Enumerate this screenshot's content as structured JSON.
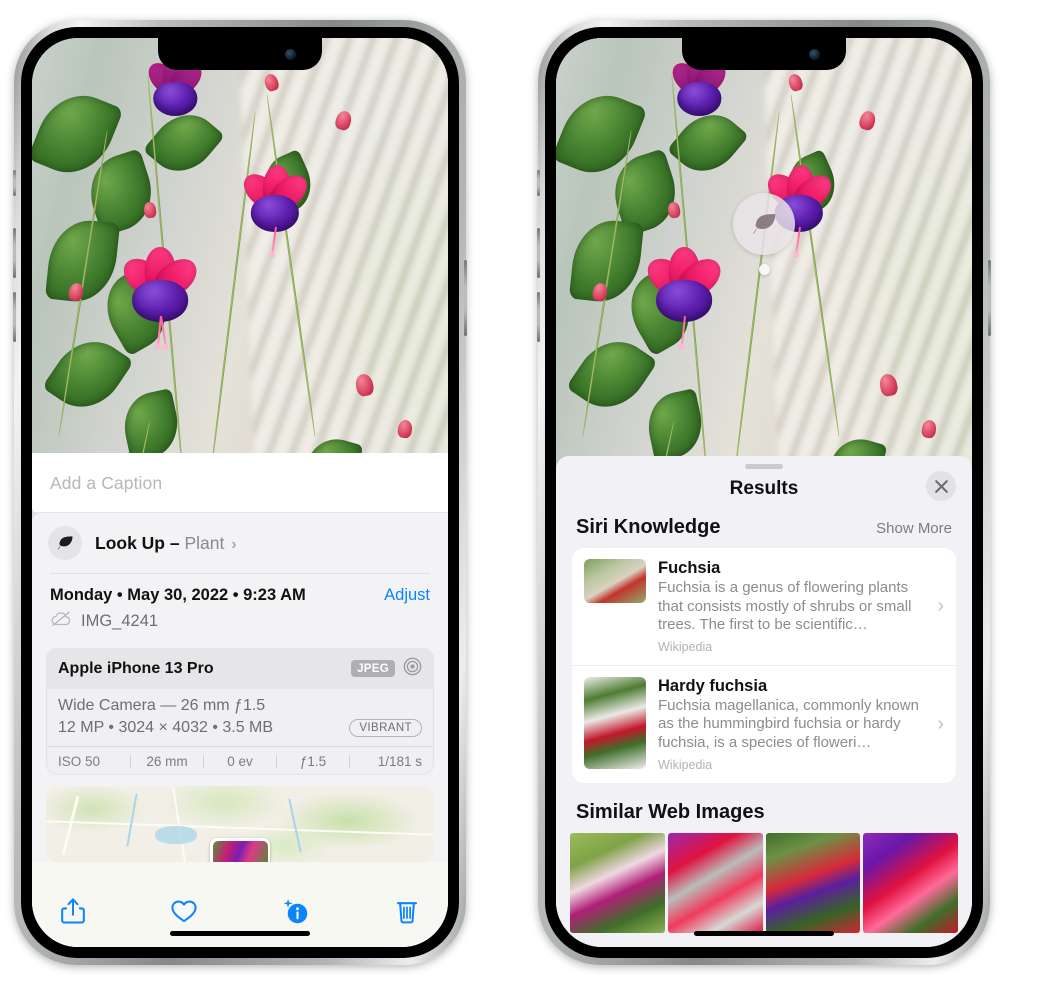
{
  "left_phone": {
    "photo": {
      "alt_name": "fuchsia-flowers-photo"
    },
    "caption": {
      "placeholder": "Add a Caption",
      "value": ""
    },
    "look_up": {
      "icon": "leaf-icon",
      "label": "Look Up",
      "separator": "–",
      "subject": "Plant",
      "chevron": "›"
    },
    "meta": {
      "date": "Monday • May 30, 2022 • 9:23 AM",
      "adjust_label": "Adjust",
      "cloud_icon": "cloud-slash-icon",
      "filename": "IMG_4241"
    },
    "exif": {
      "device": "Apple iPhone 13 Pro",
      "format_badge": "JPEG",
      "lens_icon": "aperture-icon",
      "lens": "Wide Camera — 26 mm ƒ1.5",
      "size_line": "12 MP • 3024 × 4032 • 3.5 MB",
      "style_chip": "VIBRANT",
      "stats": [
        "ISO 50",
        "26 mm",
        "0 ev",
        "ƒ1.5",
        "1/181 s"
      ]
    },
    "map": {
      "name": "location-map-strip",
      "pin": "photo-pin"
    },
    "toolbar": {
      "share": "share-icon",
      "favorite": "heart-icon",
      "info": "info-sparkle-icon",
      "delete": "trash-icon"
    }
  },
  "right_phone": {
    "photo_badge": {
      "icon": "leaf-icon",
      "name": "visual-lookup-badge"
    },
    "sheet": {
      "grabber": "sheet-grabber",
      "title": "Results",
      "close_icon": "close-icon"
    },
    "siri_knowledge": {
      "title": "Siri Knowledge",
      "show_more": "Show More",
      "items": [
        {
          "title": "Fuchsia",
          "description": "Fuchsia is a genus of flowering plants that consists mostly of shrubs or small trees. The first to be scientific…",
          "source": "Wikipedia",
          "chevron": "›"
        },
        {
          "title": "Hardy fuchsia",
          "description": "Fuchsia magellanica, commonly known as the hummingbird fuchsia or hardy fuchsia, is a species of floweri…",
          "source": "Wikipedia",
          "chevron": "›"
        }
      ]
    },
    "similar_web_images": {
      "title": "Similar Web Images",
      "thumbnails": [
        "web-image-1",
        "web-image-2",
        "web-image-3",
        "web-image-4"
      ]
    }
  },
  "colors": {
    "accent_blue": "#0a84ff",
    "sheet_bg": "#f2f1f5",
    "info_bg": "#f3f3f5",
    "card_white": "#ffffff",
    "secondary_text": "#8c8c91",
    "title_text": "#111111"
  }
}
